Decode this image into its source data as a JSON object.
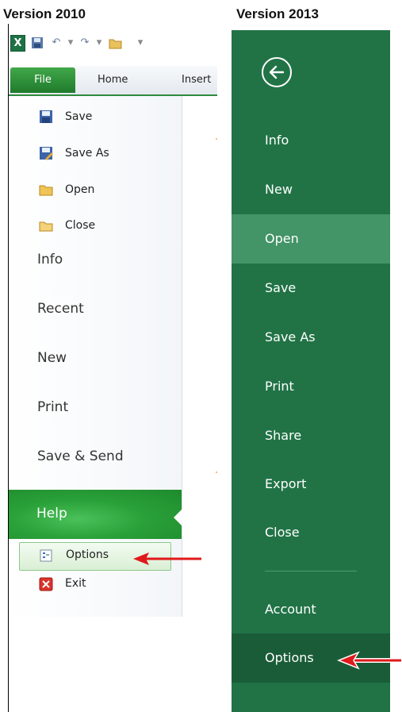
{
  "headings": {
    "v2010": "Version 2010",
    "v2013": "Version 2013"
  },
  "v2010": {
    "tabs": {
      "file": "File",
      "home": "Home",
      "insert": "Insert"
    },
    "menu_small": [
      "Save",
      "Save As",
      "Open",
      "Close"
    ],
    "menu_large": [
      "Info",
      "Recent",
      "New",
      "Print",
      "Save & Send",
      "Help"
    ],
    "options_label": "Options",
    "exit_label": "Exit"
  },
  "v2013": {
    "items": [
      "Info",
      "New",
      "Open",
      "Save",
      "Save As",
      "Print",
      "Share",
      "Export",
      "Close"
    ],
    "account_label": "Account",
    "options_label": "Options"
  },
  "colors": {
    "excel_green": "#217346",
    "selected_green": "#439467",
    "arrow_red": "#e0191b"
  }
}
